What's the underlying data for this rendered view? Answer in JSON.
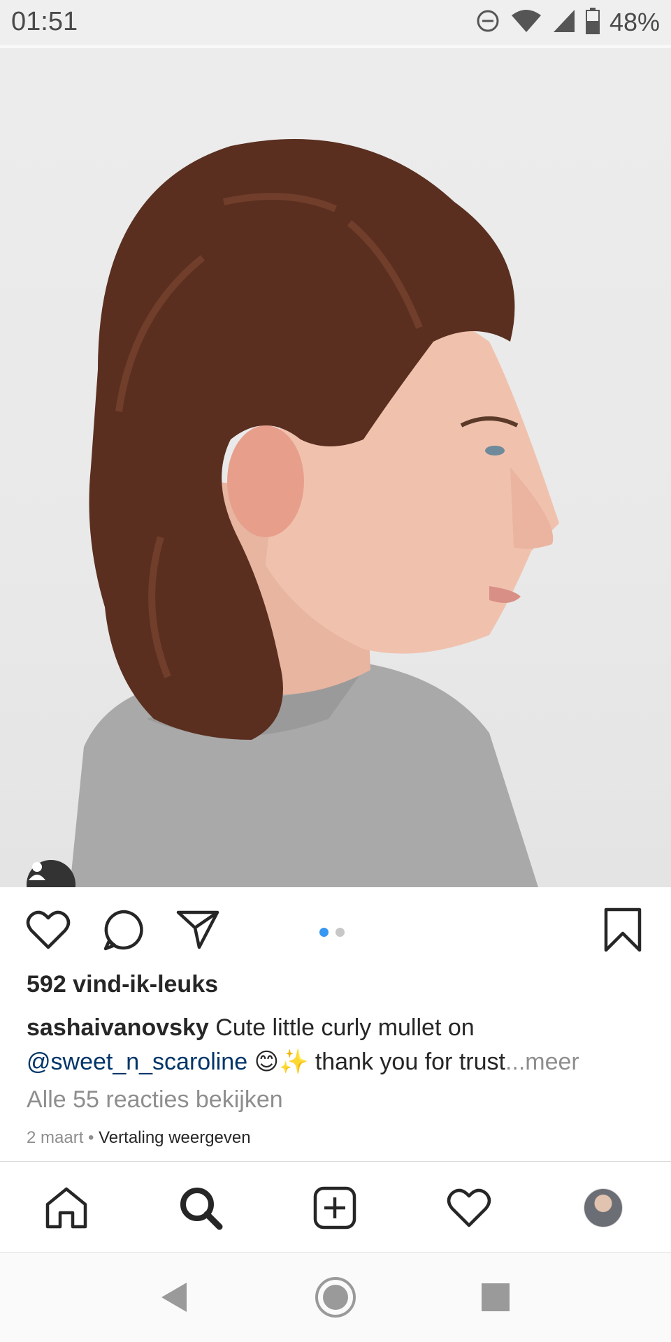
{
  "status": {
    "time": "01:51",
    "battery": "48%"
  },
  "post": {
    "likes": "592 vind-ik-leuks",
    "username": "sashaivanovsky",
    "caption_line1": " Cute little curly mullet on",
    "mention": "@sweet_n_scaroline",
    "emojis": " 😊✨ ",
    "caption_rest": "thank you for trust",
    "more": "...meer",
    "comments": "Alle 55 reacties bekijken",
    "date": "2 maart",
    "separator": " • ",
    "translate": "Vertaling weergeven",
    "carousel_total": 2,
    "carousel_active": 1
  },
  "colors": {
    "accent": "#3897f0",
    "mention": "#003569",
    "muted": "#8e8e8e"
  },
  "icons": [
    "like-icon",
    "comment-icon",
    "share-icon",
    "bookmark-icon",
    "home-icon",
    "search-icon",
    "add-post-icon",
    "activity-icon",
    "profile-avatar",
    "back-nav-icon",
    "home-nav-icon",
    "recents-nav-icon"
  ]
}
